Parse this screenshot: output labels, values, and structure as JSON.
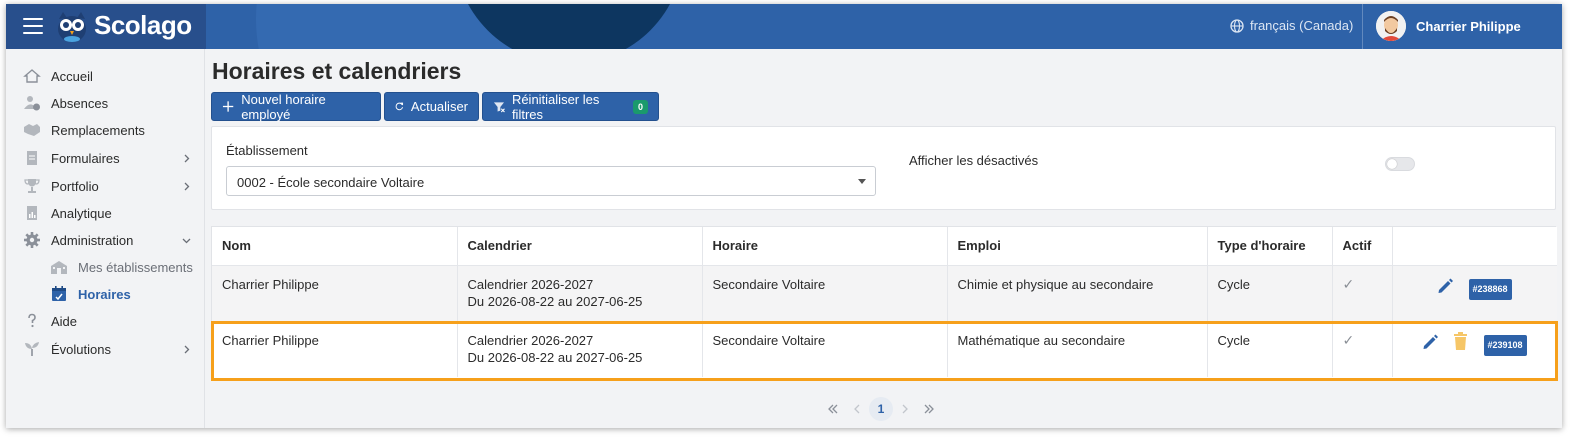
{
  "brand": {
    "name": "Scolago"
  },
  "header": {
    "language": "français (Canada)",
    "user_name": "Charrier Philippe"
  },
  "sidebar": {
    "items": [
      {
        "label": "Accueil"
      },
      {
        "label": "Absences"
      },
      {
        "label": "Remplacements"
      },
      {
        "label": "Formulaires"
      },
      {
        "label": "Portfolio"
      },
      {
        "label": "Analytique"
      },
      {
        "label": "Administration"
      },
      {
        "label": "Mes établissements"
      },
      {
        "label": "Horaires"
      },
      {
        "label": "Aide"
      },
      {
        "label": "Évolutions"
      }
    ]
  },
  "page": {
    "title": "Horaires et calendriers"
  },
  "toolbar": {
    "new_label": "Nouvel horaire employé",
    "refresh_label": "Actualiser",
    "reset_label": "Réinitialiser les filtres",
    "reset_count": "0"
  },
  "filters": {
    "establishment_label": "Établissement",
    "establishment_value": "0002 - École secondaire Voltaire",
    "show_disabled_label": "Afficher les désactivés"
  },
  "table": {
    "headers": [
      "Nom",
      "Calendrier",
      "Horaire",
      "Emploi",
      "Type d'horaire",
      "Actif",
      ""
    ],
    "rows": [
      {
        "nom": "Charrier Philippe",
        "calendrier": "Calendrier 2026-2027",
        "periode": "Du 2026-08-22 au 2027-06-25",
        "horaire": "Secondaire Voltaire",
        "emploi": "Chimie et physique au secondaire",
        "type": "Cycle",
        "actif": "✓",
        "id": "#238868"
      },
      {
        "nom": "Charrier Philippe",
        "calendrier": "Calendrier 2026-2027",
        "periode": "Du 2026-08-22 au 2027-06-25",
        "horaire": "Secondaire Voltaire",
        "emploi": "Mathématique au secondaire",
        "type": "Cycle",
        "actif": "✓",
        "id": "#239108"
      }
    ]
  },
  "pagination": {
    "current": "1"
  },
  "colors": {
    "brand_blue": "#2e62a8",
    "highlight": "#f6a01b",
    "badge_green": "#1a9a6c"
  }
}
